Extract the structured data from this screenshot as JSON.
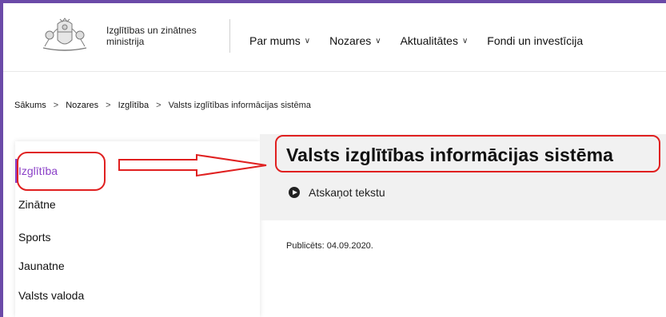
{
  "header": {
    "ministry_name": "Izglītības un zinātnes ministrija",
    "nav": [
      {
        "label": "Par mums"
      },
      {
        "label": "Nozares"
      },
      {
        "label": "Aktualitātes"
      },
      {
        "label": "Fondi un investīcija"
      }
    ]
  },
  "breadcrumb": {
    "items": [
      "Sākums",
      "Nozares",
      "Izglītība",
      "Valsts izglītības informācijas sistēma"
    ],
    "separator": ">"
  },
  "sidebar": {
    "items": [
      {
        "label": "Izglītība",
        "active": true
      },
      {
        "label": "Zinātne"
      },
      {
        "label": "Sports"
      },
      {
        "label": "Jaunatne"
      },
      {
        "label": "Valsts valoda"
      }
    ]
  },
  "main": {
    "title": "Valsts izglītības informācijas sistēma",
    "tts_label": "Atskaņot tekstu",
    "published": "Publicēts: 04.09.2020."
  },
  "colors": {
    "brand_purple": "#6b4aa8",
    "active_purple": "#8a3fc7",
    "annotation_red": "#e02020"
  },
  "icons": [
    "coat-of-arms-logo",
    "chevron-down-icon",
    "play-icon",
    "annotation-arrow"
  ]
}
